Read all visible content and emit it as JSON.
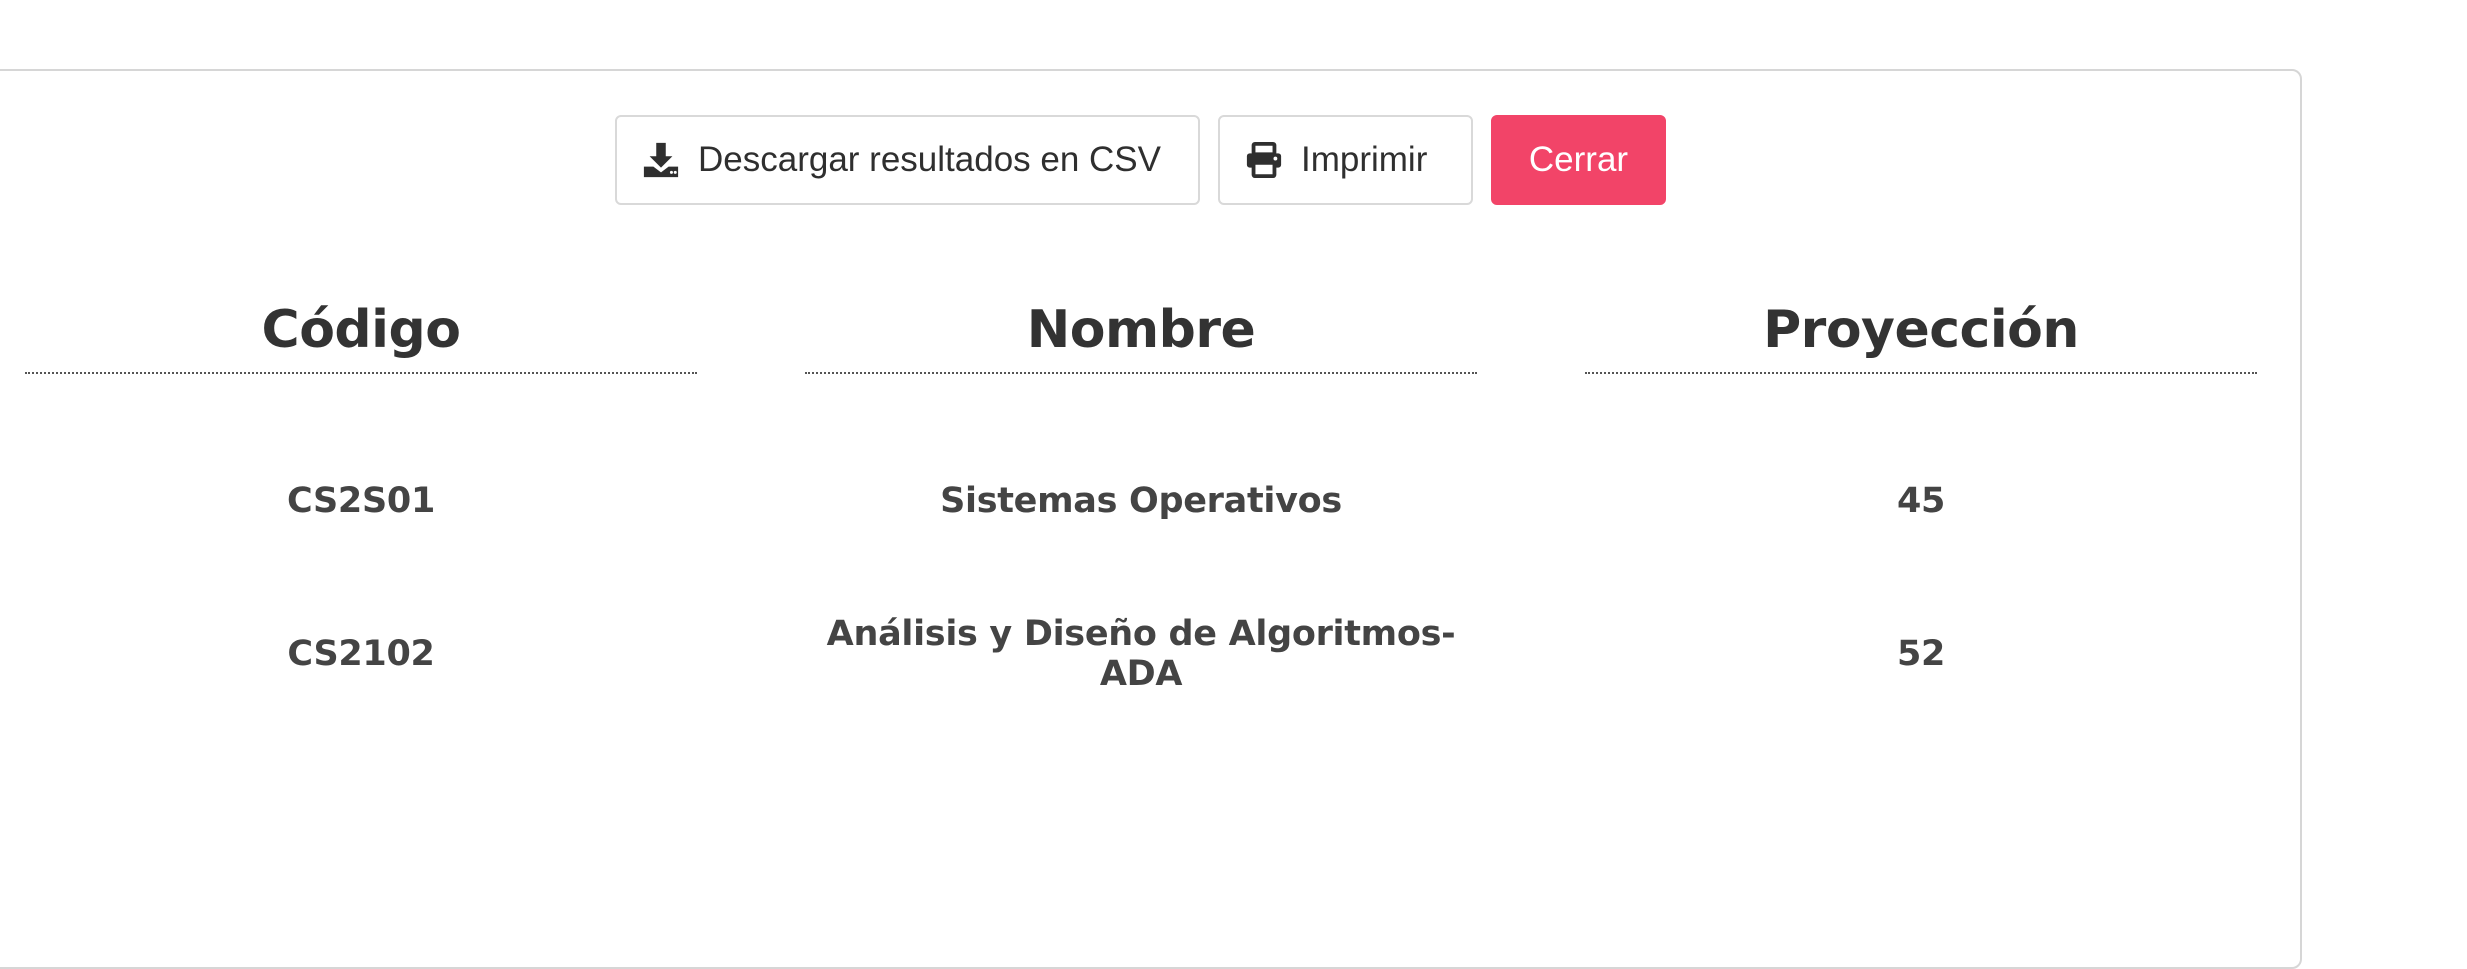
{
  "toolbar": {
    "csv_label": "Descargar resultados en CSV",
    "print_label": "Imprimir",
    "close_label": "Cerrar",
    "csv_icon": "download-icon",
    "print_icon": "printer-icon"
  },
  "colors": {
    "danger": "#f24468",
    "text": "#333333",
    "border": "#d6d6d6"
  },
  "table": {
    "headers": [
      "Código",
      "Nombre",
      "Proyección"
    ],
    "rows": [
      {
        "codigo": "CS2S01",
        "nombre": "Sistemas Operativos",
        "proyeccion": "45"
      },
      {
        "codigo": "CS2102",
        "nombre": "Análisis y Diseño de Algoritmos-ADA",
        "proyeccion": "52"
      }
    ]
  }
}
